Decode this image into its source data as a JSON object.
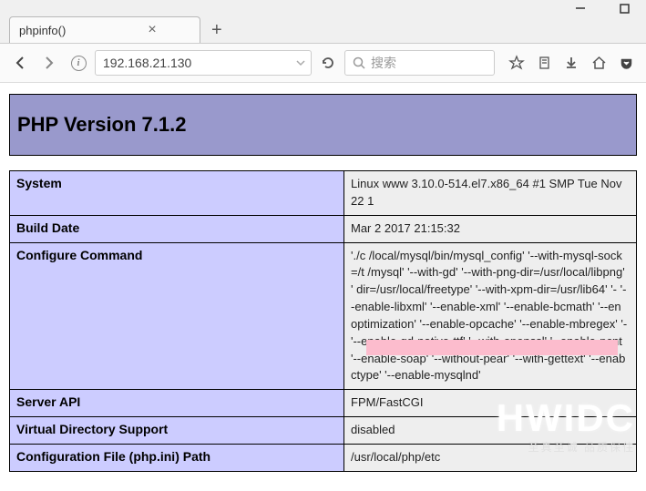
{
  "tab": {
    "title": "phpinfo()"
  },
  "nav": {
    "url": "192.168.21.130",
    "search_placeholder": "搜索"
  },
  "php": {
    "header": "PHP Version 7.1.2",
    "rows": [
      {
        "key": "System",
        "val": "Linux www 3.10.0-514.el7.x86_64 #1 SMP Tue Nov 22 1"
      },
      {
        "key": "Build Date",
        "val": "Mar 2 2017 21:15:32"
      },
      {
        "key": "Configure Command",
        "val": "'./c\n/local/mysql/bin/mysql_config' '--with-mysql-sock=/t\n/mysql' '--with-gd' '--with-png-dir=/usr/local/libpng' '\ndir=/usr/local/freetype' '--with-xpm-dir=/usr/lib64' '-\n'--enable-libxml' '--enable-xml' '--enable-bcmath' '--en\noptimization' '--enable-opcache' '--enable-mbregex' '-\n'--enable-gd-native-ttf' '--with-openssl' '--enable-pcnt\n'--enable-soap' '--without-pear' '--with-gettext' '--enab\nctype' '--enable-mysqlnd'"
      },
      {
        "key": "Server API",
        "val": "FPM/FastCGI"
      },
      {
        "key": "Virtual Directory Support",
        "val": "disabled"
      },
      {
        "key": "Configuration File (php.ini) Path",
        "val": "/usr/local/php/etc"
      }
    ]
  },
  "watermark": {
    "big": "HWIDC",
    "small": "至真至诚 品质保住"
  }
}
